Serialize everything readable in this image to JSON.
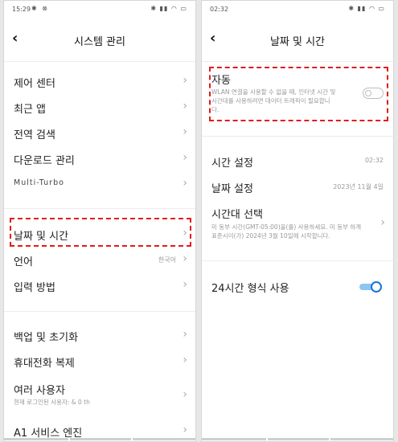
{
  "left": {
    "status": {
      "time": "15:29",
      "left_icons": "✱ ⊗",
      "right_icons": "✱ ▮▮ ◠ ▭"
    },
    "header": {
      "back": "‹",
      "title": "시스템 관리"
    },
    "items": [
      {
        "label": "제어 센터"
      },
      {
        "label": "최근 앱"
      },
      {
        "label": "전역 검색"
      },
      {
        "label": "다운로드 관리"
      },
      {
        "label": "Multi-Turbo"
      },
      {
        "label": "날짜 및 시간"
      },
      {
        "label": "언어",
        "value": "한국어"
      },
      {
        "label": "입력 방법"
      },
      {
        "label": "백업 및 초기화"
      },
      {
        "label": "휴대전화 복제"
      },
      {
        "label": "여러 사용자",
        "sub": "현재 로그인된 사용자: & 0 th"
      },
      {
        "label": "A1 서비스 엔진"
      }
    ]
  },
  "right": {
    "status": {
      "time": "02:32",
      "right_icons": "✱ ▮▮ ◠ ▭"
    },
    "header": {
      "back": "‹",
      "title": "날짜 및 시간"
    },
    "auto": {
      "label": "자동",
      "description_line1": "WLAN 연결을 사용할 수 없을 때, 인터넷 시간 및",
      "description_line2": "시간대를 사용하려면 데이터 트래픽이 필요합니",
      "description_line3": "다."
    },
    "time_setting": {
      "label": "시간 설정",
      "value": "02:32"
    },
    "date_setting": {
      "label": "날짜 설정",
      "value": "2023년 11월 4일"
    },
    "timezone": {
      "label": "시간대 선택",
      "desc_line1": "미 동부 시간(GMT-05:00)을(를) 사용하세요. 미 동부 하계",
      "desc_line2": "표준시이(가) 2024년 3월 10일에 시작합니다."
    },
    "format24": {
      "label": "24시간 형식 사용",
      "enabled": true
    }
  },
  "colors": {
    "highlight": "#e41b1b",
    "toggle_on": "#1976d2"
  }
}
